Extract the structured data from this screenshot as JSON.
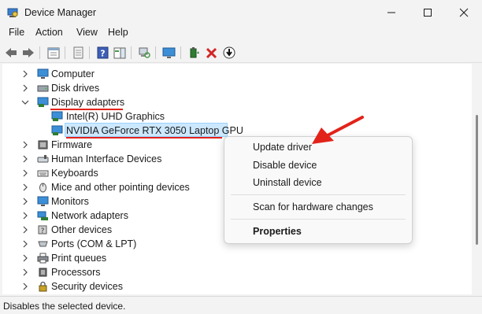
{
  "window": {
    "title": "Device Manager"
  },
  "menu": [
    "File",
    "Action",
    "View",
    "Help"
  ],
  "toolbar_icons": [
    "back-icon",
    "forward-icon",
    "properties-sheet-icon",
    "show-hidden-icon",
    "help-icon",
    "action-pane-icon",
    "computer-scan-icon",
    "monitor-icon",
    "update-driver-icon",
    "uninstall-icon",
    "download-icon"
  ],
  "tree": {
    "items": [
      {
        "label": "Computer",
        "icon": "computer-icon",
        "expanded": false
      },
      {
        "label": "Disk drives",
        "icon": "disk-drive-icon",
        "expanded": false
      },
      {
        "label": "Display adapters",
        "icon": "display-adapter-icon",
        "expanded": true
      },
      {
        "label": "Intel(R) UHD Graphics",
        "icon": "display-adapter-icon",
        "child": true
      },
      {
        "label": "NVIDIA GeForce RTX 3050 Laptop GPU",
        "icon": "display-adapter-icon",
        "child": true,
        "selected": true
      },
      {
        "label": "Firmware",
        "icon": "firmware-icon",
        "expanded": false
      },
      {
        "label": "Human Interface Devices",
        "icon": "hid-icon",
        "expanded": false
      },
      {
        "label": "Keyboards",
        "icon": "keyboard-icon",
        "expanded": false
      },
      {
        "label": "Mice and other pointing devices",
        "icon": "mouse-icon",
        "expanded": false
      },
      {
        "label": "Monitors",
        "icon": "monitor-icon",
        "expanded": false
      },
      {
        "label": "Network adapters",
        "icon": "network-adapter-icon",
        "expanded": false
      },
      {
        "label": "Other devices",
        "icon": "other-device-icon",
        "expanded": false
      },
      {
        "label": "Ports (COM & LPT)",
        "icon": "port-icon",
        "expanded": false
      },
      {
        "label": "Print queues",
        "icon": "printer-icon",
        "expanded": false
      },
      {
        "label": "Processors",
        "icon": "processor-icon",
        "expanded": false
      },
      {
        "label": "Security devices",
        "icon": "security-device-icon",
        "expanded": false
      }
    ]
  },
  "context_menu": {
    "update": "Update driver",
    "disable": "Disable device",
    "uninstall": "Uninstall device",
    "scan": "Scan for hardware changes",
    "properties": "Properties"
  },
  "status": "Disables the selected device.",
  "colors": {
    "selection": "#cce8ff",
    "annotation": "#e2231a",
    "background": "#f3f3f3"
  }
}
